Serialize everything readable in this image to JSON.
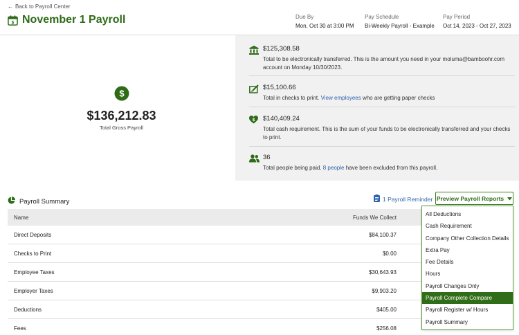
{
  "header": {
    "back_label": "Back to Payroll Center",
    "title": "November 1 Payroll",
    "due_by_label": "Due By",
    "due_by_value": "Mon, Oct 30 at 3:00 PM",
    "pay_schedule_label": "Pay Schedule",
    "pay_schedule_value": "Bi-Weekly Payroll - Example",
    "pay_period_label": "Pay Period",
    "pay_period_value": "Oct 14, 2023 - Oct 27, 2023"
  },
  "gross": {
    "amount": "$136,212.83",
    "label": "Total Gross Payroll"
  },
  "info": {
    "electronic": {
      "amount": "$125,308.58",
      "desc": "Total to be electronically transferred. This is the amount you need in your moluma@bamboohr.com account on Monday 10/30/2023."
    },
    "checks": {
      "amount": "$15,100.66",
      "desc_before": "Total in checks to print.",
      "link": "View employees",
      "desc_after": "who are getting paper checks"
    },
    "cash": {
      "amount": "$140,409.24",
      "desc": "Total cash requirement. This is the sum of your funds to be electronically transferred and your checks to print."
    },
    "people": {
      "count": "36",
      "desc_before": "Total people being paid.",
      "link": "8 people",
      "desc_after": "have been excluded from this payroll."
    }
  },
  "summary": {
    "title": "Payroll Summary",
    "reminder": "1 Payroll Reminder",
    "preview_button": "Preview Payroll Reports",
    "columns": [
      "Name",
      "Funds We Collect"
    ],
    "rows": [
      {
        "name": "Direct Deposits",
        "value": "$84,100.37"
      },
      {
        "name": "Checks to Print",
        "value": "$0.00"
      },
      {
        "name": "Employee Taxes",
        "value": "$30,643.93"
      },
      {
        "name": "Employer Taxes",
        "value": "$9,903.20"
      },
      {
        "name": "Deductions",
        "value": "$405.00"
      },
      {
        "name": "Fees",
        "value": "$256.08"
      }
    ]
  },
  "dropdown": {
    "items": [
      "All Deductions",
      "Cash Requirement",
      "Company Other Collection Details",
      "Extra Pay",
      "Fee Details",
      "Hours",
      "Payroll Changes Only",
      "Payroll Complete Compare",
      "Payroll Register w/ Hours",
      "Payroll Summary"
    ],
    "selected": "Payroll Complete Compare"
  },
  "colors": {
    "brand_green": "#2e6b17",
    "link_blue": "#2d63ad",
    "panel_gray": "#f1f1f1"
  },
  "icons": {
    "back": "arrow-left-icon",
    "title": "calendar-icon",
    "gross": "dollar-circle-icon",
    "electronic": "bank-icon",
    "checks": "check-edit-icon",
    "cash": "heart-dollar-icon",
    "people": "people-icon",
    "summary": "pie-chart-icon",
    "reminder": "clipboard-icon",
    "preview": "caret-down-icon"
  }
}
